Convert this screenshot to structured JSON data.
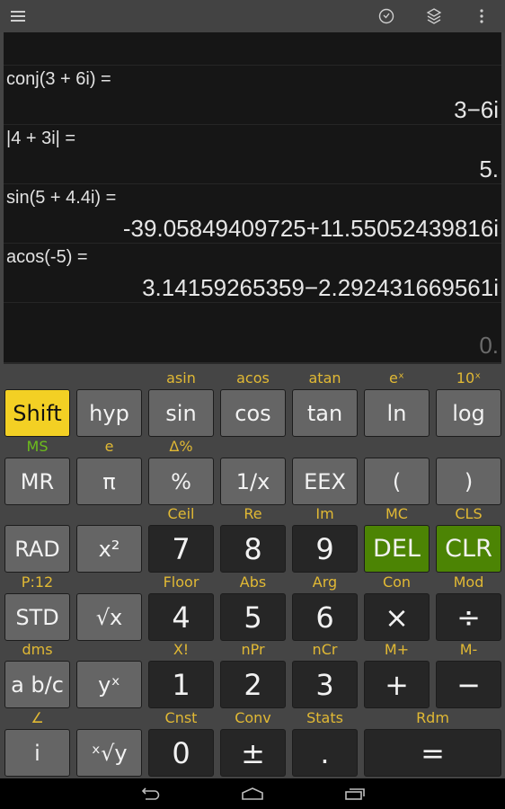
{
  "topbar": {
    "menu_icon": "hamburger-menu-icon",
    "history_icon": "clock-icon",
    "layers_icon": "layers-icon",
    "overflow_icon": "more-vert-icon"
  },
  "display": {
    "history": [
      {
        "expression": "conj(3 + 6i) =",
        "result": "3−6i"
      },
      {
        "expression": "|4 + 3i| =",
        "result": "5."
      },
      {
        "expression": "sin(5 + 4.4i) =",
        "result": "-39.05849409725+11.55052439816i"
      },
      {
        "expression": "acos(-5) =",
        "result": "3.14159265359−2.292431669561i"
      }
    ],
    "current": "0."
  },
  "keypad": {
    "rows": [
      {
        "hints": [
          "",
          "",
          "asin",
          "acos",
          "atan",
          "eˣ",
          "10ˣ"
        ],
        "keys": [
          "Shift",
          "hyp",
          "sin",
          "cos",
          "tan",
          "ln",
          "log"
        ]
      },
      {
        "hints": [
          "MS",
          "e",
          "Δ%",
          "",
          "",
          "",
          ""
        ],
        "keys": [
          "MR",
          "π",
          "%",
          "1/x",
          "EEX",
          "(",
          ")"
        ]
      },
      {
        "hints": [
          "",
          "",
          "Ceil",
          "Re",
          "Im",
          "MC",
          "CLS"
        ],
        "keys": [
          "RAD",
          "x²",
          "7",
          "8",
          "9",
          "DEL",
          "CLR"
        ]
      },
      {
        "hints": [
          "P:12",
          "",
          "Floor",
          "Abs",
          "Arg",
          "Con",
          "Mod"
        ],
        "keys": [
          "STD",
          "√x",
          "4",
          "5",
          "6",
          "×",
          "÷"
        ]
      },
      {
        "hints": [
          "dms",
          "",
          "X!",
          "nPr",
          "nCr",
          "M+",
          "M-"
        ],
        "keys": [
          "a b/c",
          "yˣ",
          "1",
          "2",
          "3",
          "+",
          "−"
        ]
      },
      {
        "hints": [
          "∠",
          "",
          "Cnst",
          "Conv",
          "Stats",
          "Rdm"
        ],
        "keys": [
          "i",
          "ˣ√y",
          "0",
          "±",
          ".",
          "="
        ]
      }
    ]
  },
  "navbar": {
    "back_icon": "back-icon",
    "home_icon": "home-icon",
    "recents_icon": "recents-icon"
  },
  "colors": {
    "shift_active": "#f3d024",
    "delete_clear": "#4c8404",
    "shift_hint": "#e1b934",
    "memory_hint": "#6dbd1c",
    "display_bg": "#161616"
  }
}
